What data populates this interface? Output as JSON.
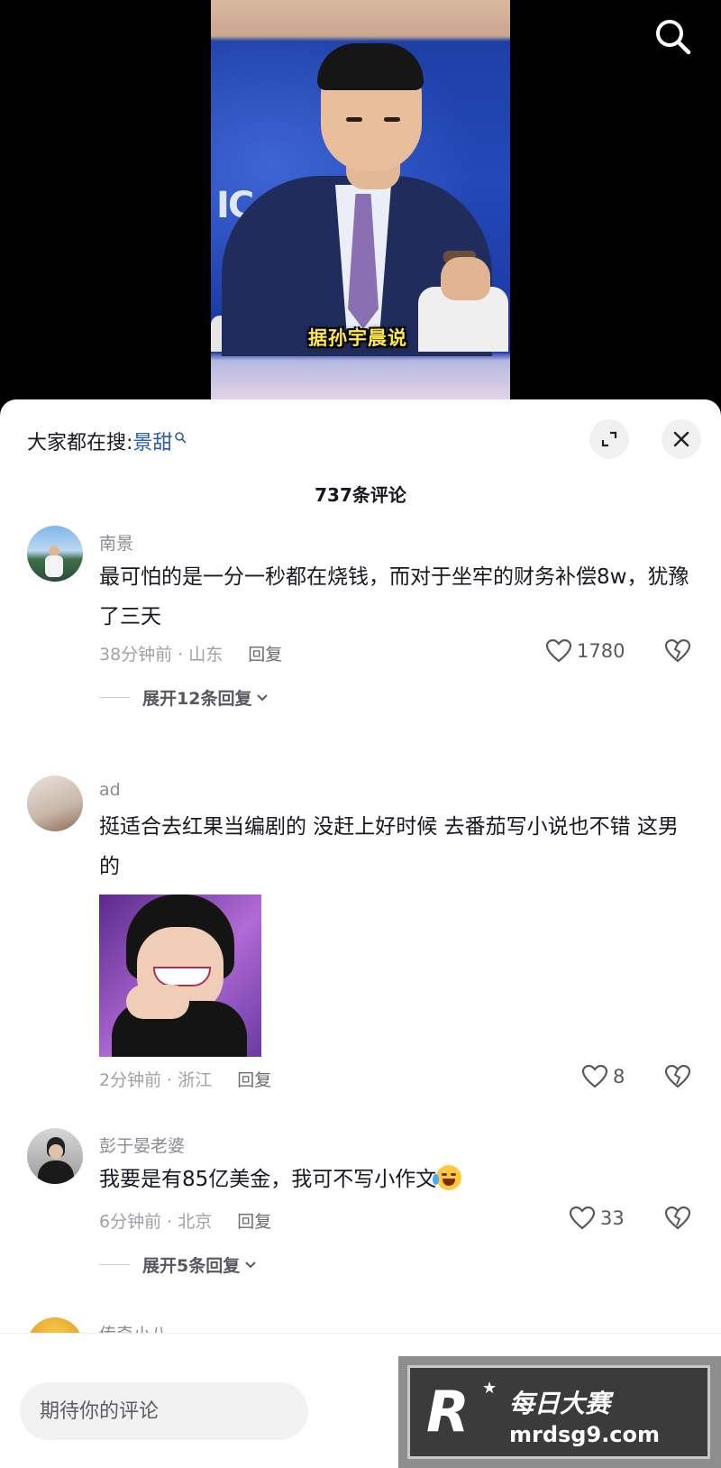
{
  "video": {
    "caption": "据孙宇晨说"
  },
  "hot_search": {
    "label": "大家都在搜:",
    "keyword": "景甜"
  },
  "comments_header": {
    "count_label": "737条评论"
  },
  "comments": [
    {
      "username": "南景",
      "text": "最可怕的是一分一秒都在烧钱，而对于坐牢的财务补偿8w，犹豫了三天",
      "time_location": "38分钟前 · 山东",
      "reply_label": "回复",
      "likes": "1780",
      "expand_label": "展开12条回复"
    },
    {
      "username": "ad",
      "text": "挺适合去红果当编剧的 没赶上好时候 去番茄写小说也不错 这男的",
      "time_location": "2分钟前 · 浙江",
      "reply_label": "回复",
      "likes": "8",
      "has_sticker": true
    },
    {
      "username": "彭于晏老婆",
      "text": "我要是有85亿美金，我可不写小作文",
      "emoji": "crying-laughing-emoji",
      "time_location": "6分钟前 · 北京",
      "reply_label": "回复",
      "likes": "33",
      "expand_label": "展开5条回复"
    },
    {
      "username": "传奇小八"
    }
  ],
  "input": {
    "placeholder": "期待你的评论"
  },
  "watermark": {
    "brand": "每日大赛",
    "url": "mrdsg9.com"
  },
  "colors": {
    "keyword": "#2a5db0",
    "caption": "#ffe94a"
  }
}
